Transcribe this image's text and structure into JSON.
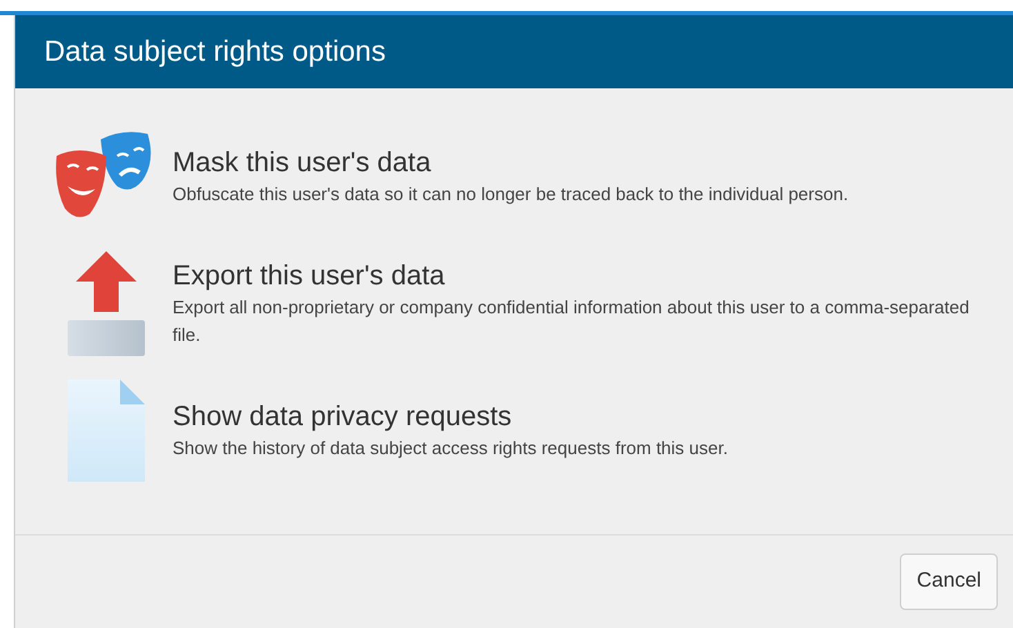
{
  "dialog": {
    "title": "Data subject rights options"
  },
  "options": [
    {
      "kind": "mask",
      "title": "Mask this user's data",
      "description": "Obfuscate this user's data so it can no longer be traced back to the individual person."
    },
    {
      "kind": "export",
      "title": "Export this user's data",
      "description": "Export all non-proprietary or company confidential information about this user to a comma-separated file."
    },
    {
      "kind": "requests",
      "title": "Show data privacy requests",
      "description": "Show the history of data subject access rights requests from this user."
    }
  ],
  "buttons": [
    {
      "label": "Cancel"
    }
  ]
}
